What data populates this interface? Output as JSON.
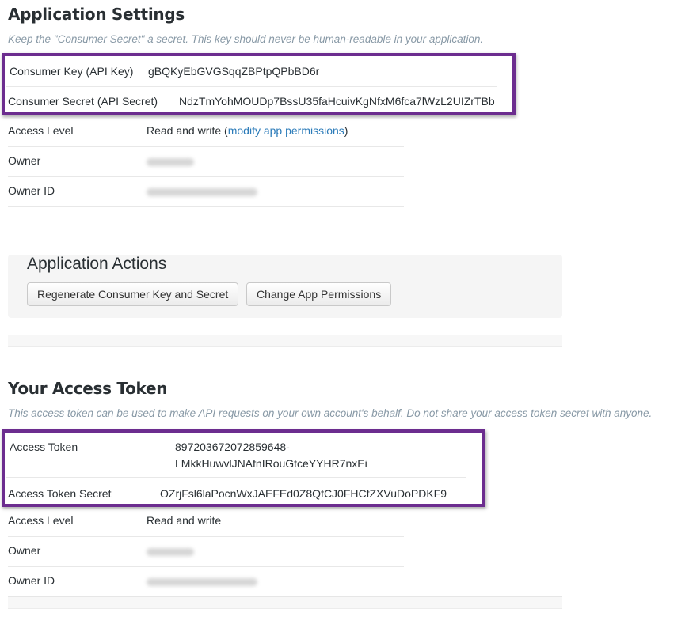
{
  "app_settings": {
    "title": "Application Settings",
    "description": "Keep the \"Consumer Secret\" a secret. This key should never be human-readable in your application.",
    "consumer_key_label": "Consumer Key (API Key)",
    "consumer_key_value": "gBQKyEbGVGSqqZBPtpQPbBD6r",
    "consumer_secret_label": "Consumer Secret (API Secret)",
    "consumer_secret_value": "NdzTmYohMOUDp7BssU35faHcuivKgNfxM6fca7lWzL2UIZrTBb",
    "access_level_label": "Access Level",
    "access_level_value": "Read and write (",
    "access_level_link": "modify app permissions",
    "access_level_close": ")",
    "owner_label": "Owner",
    "owner_id_label": "Owner ID"
  },
  "app_actions": {
    "title": "Application Actions",
    "regenerate_button": "Regenerate Consumer Key and Secret",
    "change_permissions_button": "Change App Permissions"
  },
  "access_token": {
    "title": "Your Access Token",
    "description": "This access token can be used to make API requests on your own account's behalf. Do not share your access token secret with anyone.",
    "token_label": "Access Token",
    "token_value_line1": "897203672072859648-",
    "token_value_line2": "LMkkHuwvlJNAfnIRouGtceYYHR7nxEi",
    "token_secret_label": "Access Token Secret",
    "token_secret_value": "OZrjFsl6laPocnWxJAEFEd0Z8QfCJ0FHCfZXVuDoPDKF9",
    "access_level_label": "Access Level",
    "access_level_value": "Read and write",
    "owner_label": "Owner",
    "owner_id_label": "Owner ID"
  },
  "colors": {
    "highlight_border": "#6c2d8f",
    "link": "#2b7bb9",
    "muted_text": "#8899a6"
  }
}
